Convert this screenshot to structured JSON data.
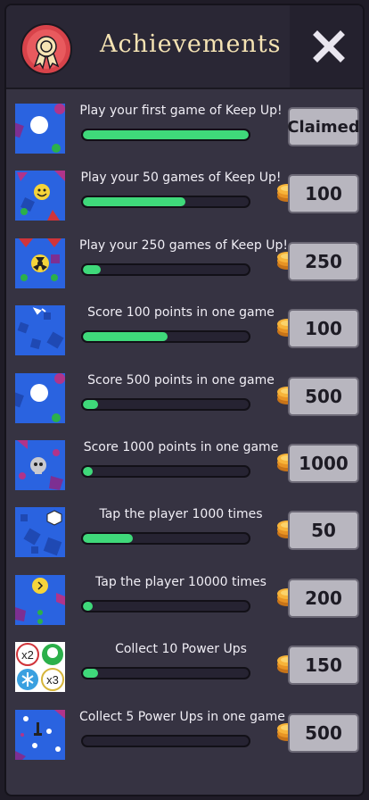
{
  "header": {
    "title": "Achievements",
    "badge_icon": "medal-icon",
    "close_icon": "close-icon"
  },
  "colors": {
    "accent_green": "#3fd97a",
    "title_gold": "#f5e3b3",
    "panel": "#363342",
    "thumb_blue": "#2a63e0"
  },
  "achievements": [
    {
      "label": "Play your first game of Keep Up!",
      "progress": 1.0,
      "reward": "Claimed",
      "claimed": true,
      "thumb_icon": "ball-icon"
    },
    {
      "label": "Play your 50 games of Keep Up!",
      "progress": 0.62,
      "reward": "100",
      "claimed": false,
      "thumb_icon": "smiley-ball-icon"
    },
    {
      "label": "Play your 250 games of Keep Up!",
      "progress": 0.11,
      "reward": "250",
      "claimed": false,
      "thumb_icon": "radioactive-ball-icon"
    },
    {
      "label": "Score 100 points in one game",
      "progress": 0.51,
      "reward": "100",
      "claimed": false,
      "thumb_icon": "broken-ball-icon"
    },
    {
      "label": "Score 500 points in one game",
      "progress": 0.09,
      "reward": "500",
      "claimed": false,
      "thumb_icon": "ball-icon"
    },
    {
      "label": "Score 1000 points in one game",
      "progress": 0.04,
      "reward": "1000",
      "claimed": false,
      "thumb_icon": "skull-ball-icon"
    },
    {
      "label": "Tap the player 1000 times",
      "progress": 0.3,
      "reward": "50",
      "claimed": false,
      "thumb_icon": "hexagon-ball-icon"
    },
    {
      "label": "Tap the player 10000 times",
      "progress": 0.03,
      "reward": "200",
      "claimed": false,
      "thumb_icon": "lightbulb-ball-icon"
    },
    {
      "label": "Collect 10 Power Ups",
      "progress": 0.09,
      "reward": "150",
      "claimed": false,
      "thumb_icon": "power-ups-icon"
    },
    {
      "label": "Collect 5 Power Ups in one game",
      "progress": 0.0,
      "reward": "500",
      "claimed": false,
      "thumb_icon": "sword-ball-icon"
    }
  ],
  "thumb_text": {
    "x2": "x2",
    "x3": "x3"
  }
}
